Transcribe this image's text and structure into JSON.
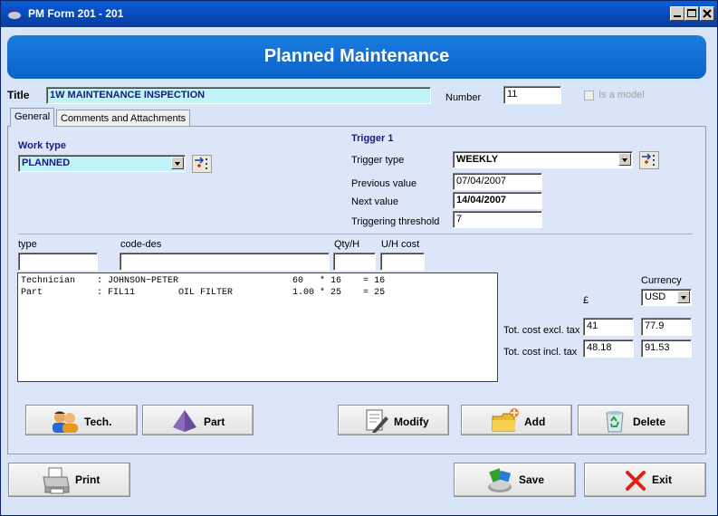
{
  "window": {
    "title": "PM Form 201 - 201"
  },
  "header": {
    "title": "Planned Maintenance"
  },
  "form": {
    "title_label": "Title",
    "title_value": "1W MAINTENANCE INSPECTION",
    "number_label": "Number",
    "number_value": "11",
    "is_model_label": "Is a model"
  },
  "tabs": [
    "General",
    "Comments and Attachments"
  ],
  "work_type": {
    "label": "Work type",
    "value": "PLANNED"
  },
  "trigger": {
    "heading": "Trigger 1",
    "type_label": "Trigger type",
    "type_value": "WEEKLY",
    "previous_label": "Previous value",
    "previous_value": "07/04/2007",
    "next_label": "Next value",
    "next_value": "14/04/2007",
    "threshold_label": "Triggering threshold",
    "threshold_value": "7"
  },
  "entry": {
    "type_label": "type",
    "code_label": "code-des",
    "qty_label": "Qty/H",
    "cost_label": "U/H cost"
  },
  "tasks": [
    "Technician    : JOHNSON~PETER                     60   * 16    = 16",
    "Part          : FIL11        OIL FILTER           1.00 * 25    = 25"
  ],
  "costs": {
    "pound_symbol": "£",
    "currency_label": "Currency",
    "currency_value": "USD",
    "excl_label": "Tot. cost excl. tax",
    "excl_gbp": "41",
    "excl_usd": "77.9",
    "incl_label": "Tot. cost incl. tax",
    "incl_gbp": "48.18",
    "incl_usd": "91.53"
  },
  "buttons": {
    "tech": "Tech.",
    "part": "Part",
    "modify": "Modify",
    "add": "Add",
    "delete": "Delete",
    "print": "Print",
    "save": "Save",
    "exit": "Exit"
  },
  "colors": {
    "titlebar": "#0a5fd8",
    "banner": "#1a7ce0",
    "field_highlight": "#bff3f5",
    "exit_x": "#e02010"
  }
}
